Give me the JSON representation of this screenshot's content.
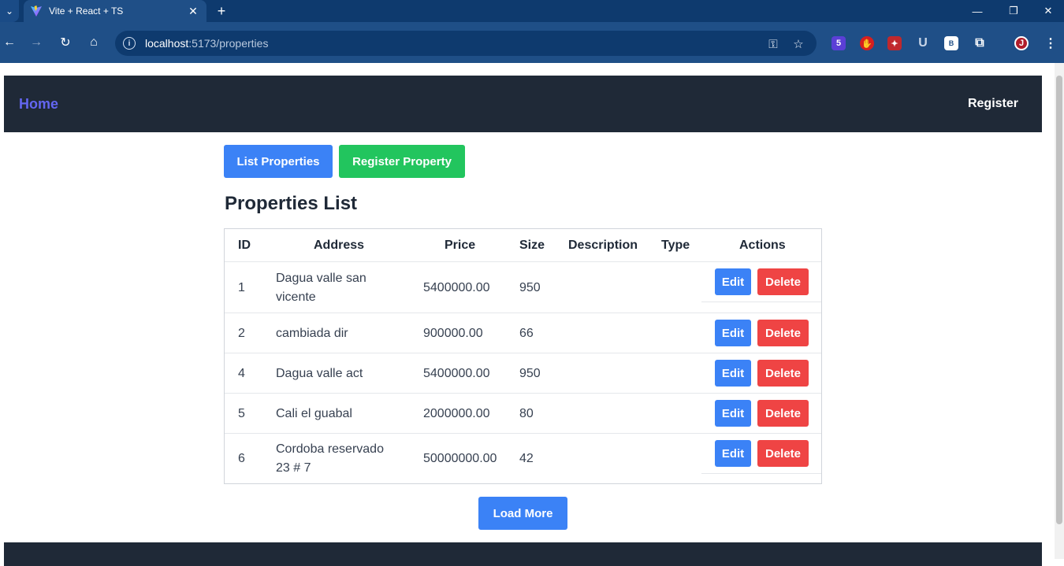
{
  "browser": {
    "tab_title": "Vite + React + TS",
    "url_host": "localhost",
    "url_path": ":5173/properties",
    "extension_badge": "5",
    "ext_b_label": "B",
    "ext_u_label": "U",
    "colors": {
      "tabbar": "#0e3a6e",
      "toolbar": "#1f4f87"
    }
  },
  "nav": {
    "home": "Home",
    "register": "Register"
  },
  "buttons": {
    "list": "List Properties",
    "register_property": "Register Property",
    "load_more": "Load More"
  },
  "heading": "Properties List",
  "table": {
    "columns": [
      "ID",
      "Address",
      "Price",
      "Size",
      "Description",
      "Type",
      "Actions"
    ],
    "edit_label": "Edit",
    "delete_label": "Delete",
    "rows": [
      {
        "id": "1",
        "address_line1": "Dagua valle san",
        "address_line2": "vicente",
        "price": "5400000.00",
        "size": "950",
        "description": "",
        "type": ""
      },
      {
        "id": "2",
        "address_line1": "cambiada dir",
        "address_line2": "",
        "price": "900000.00",
        "size": "66",
        "description": "",
        "type": ""
      },
      {
        "id": "4",
        "address_line1": "Dagua valle act",
        "address_line2": "",
        "price": "5400000.00",
        "size": "950",
        "description": "",
        "type": ""
      },
      {
        "id": "5",
        "address_line1": "Cali el guabal",
        "address_line2": "",
        "price": "2000000.00",
        "size": "80",
        "description": "",
        "type": ""
      },
      {
        "id": "6",
        "address_line1": "Cordoba reservado",
        "address_line2": "23 # 7",
        "price": "50000000.00",
        "size": "42",
        "description": "",
        "type": ""
      }
    ]
  },
  "colors": {
    "nav_bg": "#1f2937",
    "home_link": "#6366f1",
    "primary": "#3b82f6",
    "success": "#22c55e",
    "danger": "#ef4444"
  }
}
